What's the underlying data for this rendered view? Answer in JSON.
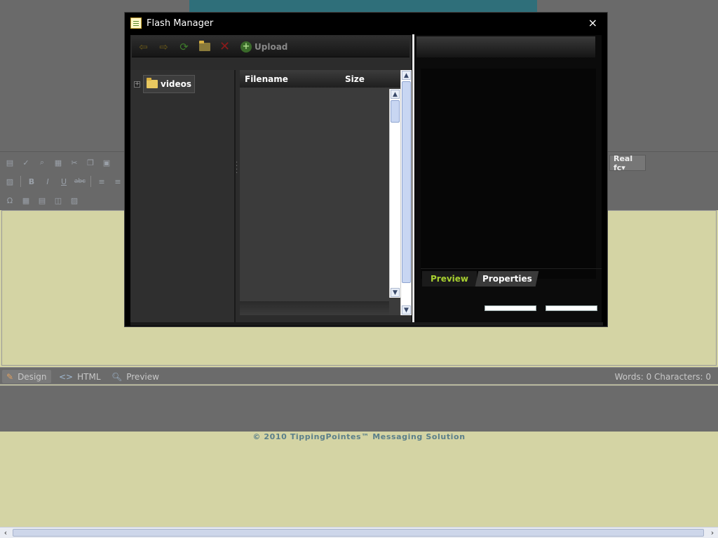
{
  "dialog": {
    "title": "Flash Manager",
    "close_glyph": "×",
    "toolbar": {
      "back_icon": "arrow-left-icon",
      "forward_icon": "arrow-right-icon",
      "refresh_icon": "refresh-icon",
      "new_folder_icon": "new-folder-icon",
      "delete_icon": "delete-icon",
      "upload_label": "Upload"
    },
    "tree": {
      "expand_glyph": "+",
      "root_label": "videos"
    },
    "file_list": {
      "columns": [
        "Filename",
        "Size"
      ]
    },
    "tabs": [
      "Preview",
      "Properties"
    ]
  },
  "editor": {
    "font_select": "Real fc▾",
    "modes": [
      "Design",
      "HTML",
      "Preview"
    ],
    "counts": "Words: 0   Characters: 0"
  },
  "footer": "© 2010 TippingPointes™ Messaging Solution",
  "colors": {
    "accent_green": "#a8d030",
    "dialog_bg": "#000000",
    "page_bg": "#d4d4a4"
  }
}
